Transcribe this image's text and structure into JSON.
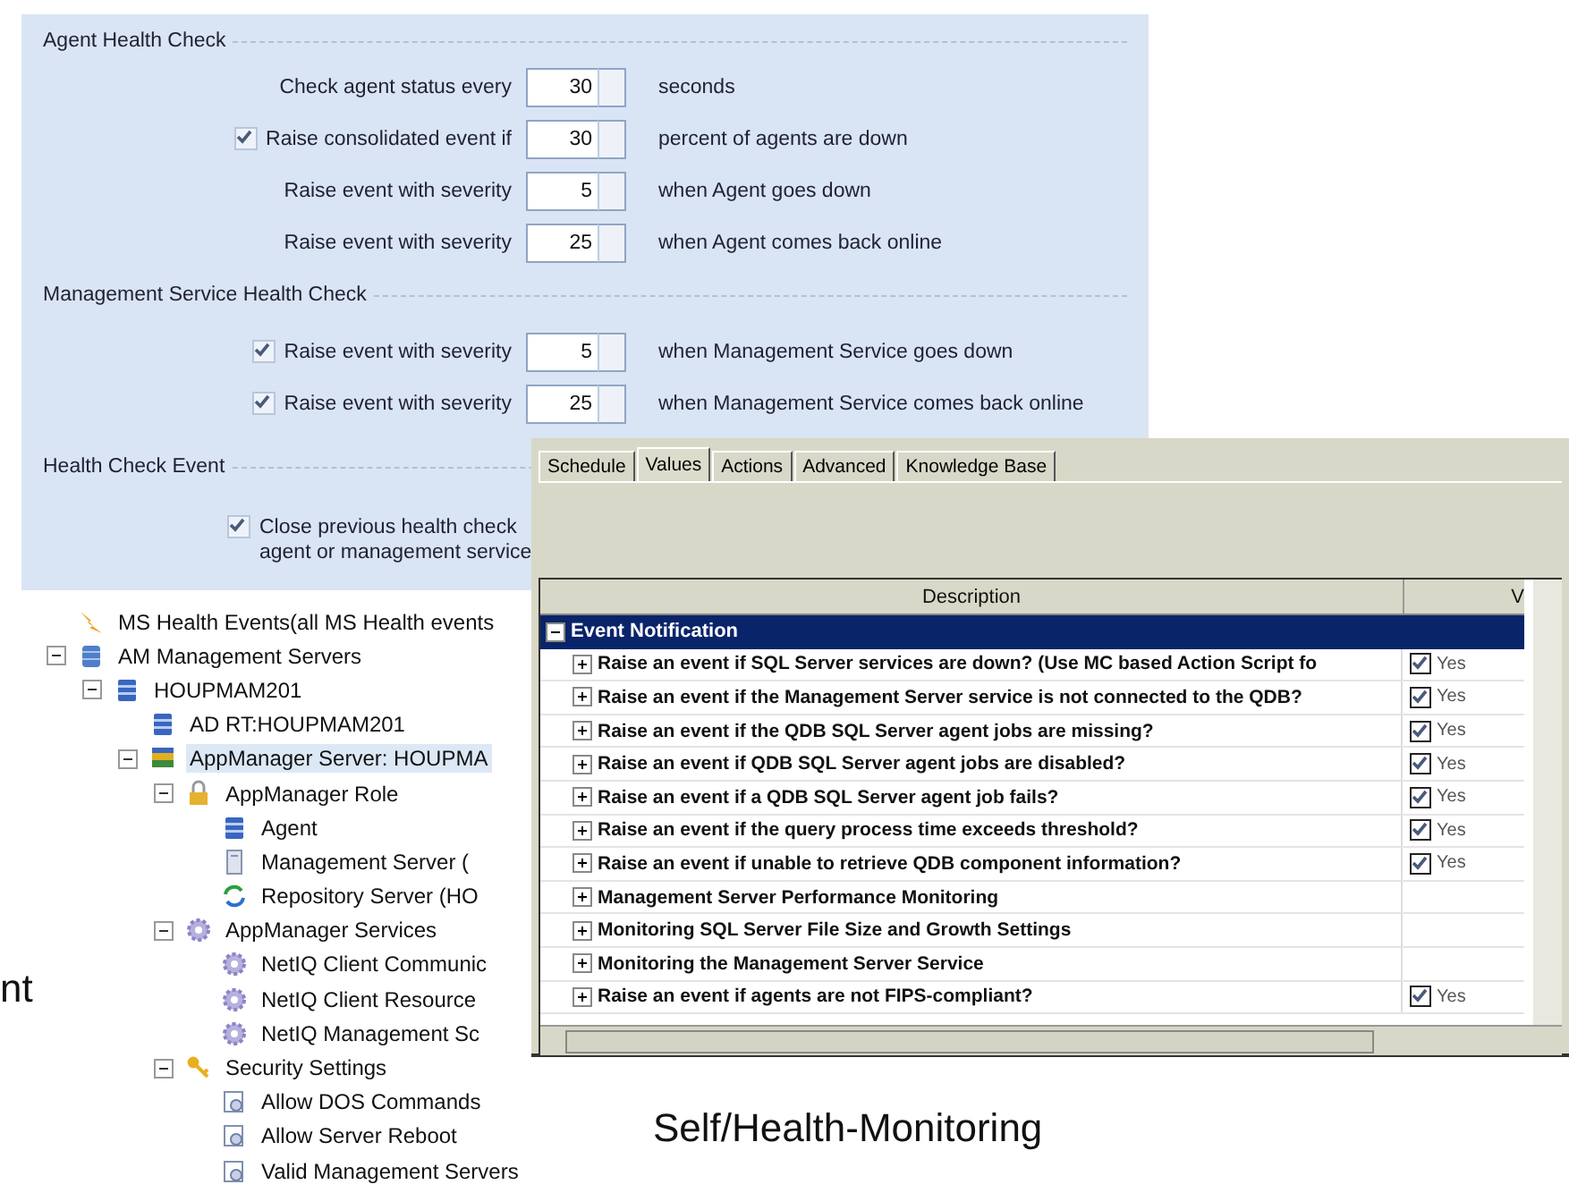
{
  "agent_health_check": {
    "title": "Agent Health Check",
    "rows": [
      {
        "label": "Check agent status every",
        "value": "30",
        "suffix": "seconds"
      },
      {
        "label": "Raise consolidated event if",
        "checked": true,
        "value": "30",
        "suffix": "percent of agents are down"
      },
      {
        "label": "Raise event with severity",
        "value": "5",
        "suffix": "when Agent goes down"
      },
      {
        "label": "Raise event with severity",
        "value": "25",
        "suffix": "when Agent comes back online"
      }
    ]
  },
  "management_service_health_check": {
    "title": "Management Service Health Check",
    "rows": [
      {
        "label": "Raise event with severity",
        "checked": true,
        "value": "5",
        "suffix": "when Management Service goes down"
      },
      {
        "label": "Raise event with severity",
        "checked": true,
        "value": "25",
        "suffix": "when Management Service comes back online"
      }
    ]
  },
  "health_check_event": {
    "title": "Health Check Event",
    "option": {
      "label": "Close previous health check",
      "label_line_2": "agent or management service",
      "checked": true
    }
  },
  "tree": [
    {
      "label": "MS Health Events(all MS Health events",
      "kind": "lightning",
      "selected": false
    },
    {
      "label": "AM Management Servers",
      "kind": "server-stack",
      "expanded": true,
      "selected": false,
      "children": [
        {
          "label": "HOUPMAM201",
          "kind": "server",
          "expanded": true,
          "selected": false,
          "children": [
            {
              "label": "AD RT:HOUPMAM201",
              "kind": "server",
              "selected": false
            },
            {
              "label": "AppManager Server: HOUPMA",
              "kind": "books",
              "expanded": true,
              "selected": true,
              "children": [
                {
                  "label": "AppManager Role",
                  "kind": "lock",
                  "expanded": true,
                  "selected": false,
                  "children": [
                    {
                      "label": "Agent",
                      "kind": "server",
                      "selected": false
                    },
                    {
                      "label": "Management Server (",
                      "kind": "tower",
                      "selected": false
                    },
                    {
                      "label": "Repository Server (HO",
                      "kind": "sync",
                      "selected": false
                    }
                  ]
                },
                {
                  "label": "AppManager Services",
                  "kind": "gear",
                  "expanded": true,
                  "selected": false,
                  "children": [
                    {
                      "label": "NetIQ Client Communic",
                      "kind": "gear",
                      "selected": false
                    },
                    {
                      "label": "NetIQ Client Resource",
                      "kind": "gear",
                      "selected": false
                    },
                    {
                      "label": "NetIQ Management Sc",
                      "kind": "gear",
                      "selected": false
                    }
                  ]
                },
                {
                  "label": "Security Settings",
                  "kind": "key",
                  "expanded": true,
                  "selected": false,
                  "children": [
                    {
                      "label": "Allow DOS Commands",
                      "kind": "document",
                      "selected": false
                    },
                    {
                      "label": "Allow Server Reboot",
                      "kind": "document",
                      "selected": false
                    },
                    {
                      "label": "Valid Management Servers",
                      "kind": "document",
                      "selected": false
                    }
                  ]
                }
              ]
            }
          ]
        }
      ]
    }
  ],
  "dialog": {
    "tabs": [
      {
        "label": "Schedule",
        "selected": false
      },
      {
        "label": "Values",
        "selected": true
      },
      {
        "label": "Actions",
        "selected": false
      },
      {
        "label": "Advanced",
        "selected": false
      },
      {
        "label": "Knowledge Base",
        "selected": false
      }
    ],
    "columns": [
      "Description",
      "V"
    ],
    "rows": [
      {
        "kind": "group",
        "label": "Event Notification",
        "expanded": true,
        "selected": true
      },
      {
        "kind": "option",
        "label": "Raise an event if SQL Server services are down? (Use MC based Action Script fo",
        "checked": true,
        "value": "Yes"
      },
      {
        "kind": "option",
        "label": "Raise an event if the Management Server service is not connected to the QDB?",
        "checked": true,
        "value": "Yes"
      },
      {
        "kind": "option",
        "label": "Raise an event if the QDB SQL Server agent jobs are missing?",
        "checked": true,
        "value": "Yes"
      },
      {
        "kind": "option",
        "label": "Raise an event if QDB SQL Server agent jobs are disabled?",
        "checked": true,
        "value": "Yes"
      },
      {
        "kind": "option",
        "label": "Raise an event if a QDB SQL Server agent job fails?",
        "checked": true,
        "value": "Yes"
      },
      {
        "kind": "option",
        "label": "Raise an event if the query process time exceeds threshold?",
        "checked": true,
        "value": "Yes"
      },
      {
        "kind": "option",
        "label": "Raise an event if unable to retrieve QDB component information?",
        "checked": true,
        "value": "Yes"
      },
      {
        "kind": "section",
        "label": "Management Server Performance Monitoring"
      },
      {
        "kind": "section",
        "label": "Monitoring SQL Server File Size and Growth Settings"
      },
      {
        "kind": "section",
        "label": "Monitoring the Management Server Service"
      },
      {
        "kind": "option",
        "label": "Raise an event if agents are not FIPS-compliant?",
        "checked": true,
        "value": "Yes"
      }
    ]
  },
  "caption": "Self/Health-Monitoring",
  "text_fragment": "nt"
}
